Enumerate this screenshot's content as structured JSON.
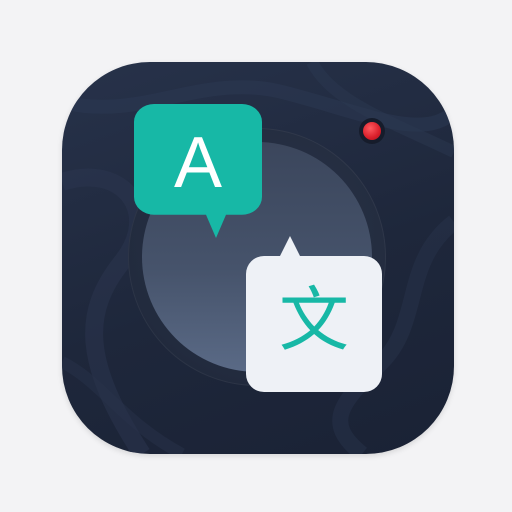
{
  "icon": {
    "name": "translator-app-icon",
    "source_letter": "A",
    "target_glyph": "文",
    "colors": {
      "background": "#f3f3f5",
      "tile": "#1e273b",
      "accent": "#17b8a6",
      "bubble_light": "#eef1f6",
      "record": "#e0232e"
    },
    "icons": [
      "speech-bubble-icon",
      "camera-lens-icon",
      "record-indicator-icon"
    ]
  }
}
